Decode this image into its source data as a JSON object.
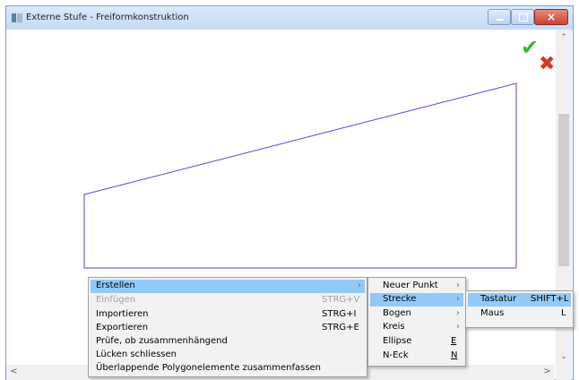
{
  "window": {
    "title": "Externe Stufe - Freiformkonstruktion",
    "close_glyph": "×"
  },
  "icons": {
    "ok": "✔",
    "cancel": "✖",
    "submenu_arrow": "›",
    "scroll_up": "⌃",
    "scroll_down": "⌄",
    "scroll_left": "<",
    "scroll_right": ">"
  },
  "shape": {
    "stroke_color": "#4a4ad8"
  },
  "context_menu": {
    "items": [
      {
        "label": "Erstellen",
        "shortcut": "",
        "has_submenu": true,
        "highlighted": true,
        "disabled": false
      },
      {
        "label": "Einfügen",
        "shortcut": "STRG+V",
        "has_submenu": false,
        "highlighted": false,
        "disabled": true
      },
      {
        "label": "Importieren",
        "shortcut": "STRG+I",
        "has_submenu": false,
        "highlighted": false,
        "disabled": false
      },
      {
        "label": "Exportieren",
        "shortcut": "STRG+E",
        "has_submenu": false,
        "highlighted": false,
        "disabled": false
      },
      {
        "label": "Prüfe, ob zusammenhängend",
        "shortcut": "",
        "has_submenu": false,
        "highlighted": false,
        "disabled": false
      },
      {
        "label": "Lücken schliessen",
        "shortcut": "",
        "has_submenu": false,
        "highlighted": false,
        "disabled": false
      },
      {
        "label": "Überlappende Polygonelemente zusammenfassen",
        "shortcut": "",
        "has_submenu": false,
        "highlighted": false,
        "disabled": false
      }
    ]
  },
  "submenu_erstellen": {
    "items": [
      {
        "label": "Neuer Punkt",
        "shortcut": "",
        "has_submenu": true,
        "highlighted": false
      },
      {
        "label": "Strecke",
        "shortcut": "",
        "has_submenu": true,
        "highlighted": true
      },
      {
        "label": "Bogen",
        "shortcut": "",
        "has_submenu": true,
        "highlighted": false
      },
      {
        "label": "Kreis",
        "shortcut": "",
        "has_submenu": true,
        "highlighted": false
      },
      {
        "label": "Ellipse",
        "shortcut": "E",
        "has_submenu": false,
        "highlighted": false
      },
      {
        "label": "N-Eck",
        "shortcut": "N",
        "has_submenu": false,
        "highlighted": false
      }
    ]
  },
  "submenu_strecke": {
    "items": [
      {
        "label": "Tastatur",
        "shortcut": "SHIFT+L",
        "highlighted": true
      },
      {
        "label": "Maus",
        "shortcut": "L",
        "highlighted": false
      }
    ]
  },
  "colors": {
    "highlight": "#91c9f7",
    "ok_green": "#3cb43c",
    "cancel_red": "#d23a2a"
  }
}
